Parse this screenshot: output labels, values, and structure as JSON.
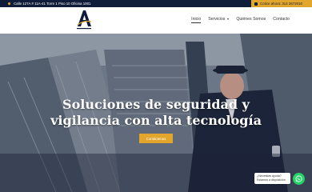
{
  "topbar": {
    "address": "Calle 127A # 11A-41 Torre 1 Piso 10 Oficina 1001",
    "phone": "Cotice ahora: 314 3672010"
  },
  "nav": {
    "items": [
      {
        "label": "Inicio",
        "active": true
      },
      {
        "label": "Servicios",
        "dropdown": true
      },
      {
        "label": "Quiénes Somos"
      },
      {
        "label": "Contacto"
      }
    ]
  },
  "hero": {
    "title_line1": "Soluciones de seguridad y",
    "title_line2": "vigilancia con alta tecnología",
    "cta": "Contáctenos"
  },
  "chat": {
    "line1": "¿Necesitas ayuda?",
    "line2": "Estamos a disposición"
  },
  "colors": {
    "navy": "#0f1d3a",
    "gold": "#e1a62b",
    "whatsapp": "#26d366"
  },
  "icons": [
    "location-pin-icon",
    "phone-icon",
    "whatsapp-icon",
    "logo-a"
  ]
}
